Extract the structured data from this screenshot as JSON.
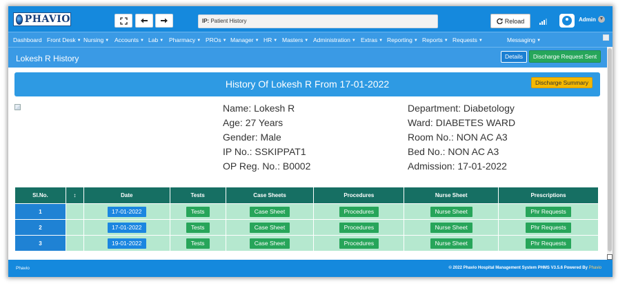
{
  "app": {
    "logo_text": "PHAVIO"
  },
  "toolbar": {
    "search_label": "IP:",
    "search_value": "Patient History",
    "reload_label": "Reload",
    "user_name": "Admin"
  },
  "nav": [
    {
      "label": "Dashboard",
      "caret": false
    },
    {
      "label": "Front Desk",
      "caret": true
    },
    {
      "label": "Nursing",
      "caret": true
    },
    {
      "label": "Accounts",
      "caret": true
    },
    {
      "label": "Lab",
      "caret": true
    },
    {
      "label": "Pharmacy",
      "caret": true
    },
    {
      "label": "PROs",
      "caret": true
    },
    {
      "label": "Manager",
      "caret": true
    },
    {
      "label": "HR",
      "caret": true
    },
    {
      "label": "Masters",
      "caret": true
    },
    {
      "label": "Administration",
      "caret": true
    },
    {
      "label": "Extras",
      "caret": true
    },
    {
      "label": "Reporting",
      "caret": true
    },
    {
      "label": "Reports",
      "caret": true
    },
    {
      "label": "Requests",
      "caret": true
    },
    {
      "label": "Messaging",
      "caret": true
    }
  ],
  "page": {
    "title": "Lokesh R History",
    "details_label": "Details",
    "discharge_sent_label": "Discharge Request Sent"
  },
  "banner": {
    "title": "History Of Lokesh R From 17-01-2022",
    "summary_label": "Discharge Summary"
  },
  "patient": {
    "left": [
      "Name: Lokesh R",
      "Age: 27 Years",
      "Gender: Male",
      "IP No.: SSKIPPAT1",
      "OP Reg. No.: B0002"
    ],
    "right": [
      "Department: Diabetology",
      "Ward: DIABETES WARD",
      "Room No.: NON AC A3",
      "Bed No.: NON AC A3",
      "Admission: 17-01-2022"
    ]
  },
  "table": {
    "headers": [
      "Sl.No.",
      "↕",
      "Date",
      "Tests",
      "Case Sheets",
      "Procedures",
      "Nurse Sheet",
      "Prescriptions"
    ],
    "rows": [
      {
        "sl": "1",
        "date": "17-01-2022",
        "tests": "Tests",
        "case": "Case Sheet",
        "proc": "Procedures",
        "nurse": "Nurse Sheet",
        "presc": "Phr Requests"
      },
      {
        "sl": "2",
        "date": "17-01-2022",
        "tests": "Tests",
        "case": "Case Sheet",
        "proc": "Procedures",
        "nurse": "Nurse Sheet",
        "presc": "Phr Requests"
      },
      {
        "sl": "3",
        "date": "19-01-2022",
        "tests": "Tests",
        "case": "Case Sheet",
        "proc": "Procedures",
        "nurse": "Nurse Sheet",
        "presc": "Phr Requests"
      }
    ]
  },
  "footer": {
    "left": "Phavio",
    "right_text": "© 2022 Phavio Hospital Management System PHMS V3.5.6 Powered By ",
    "right_brand": "Phavio"
  }
}
